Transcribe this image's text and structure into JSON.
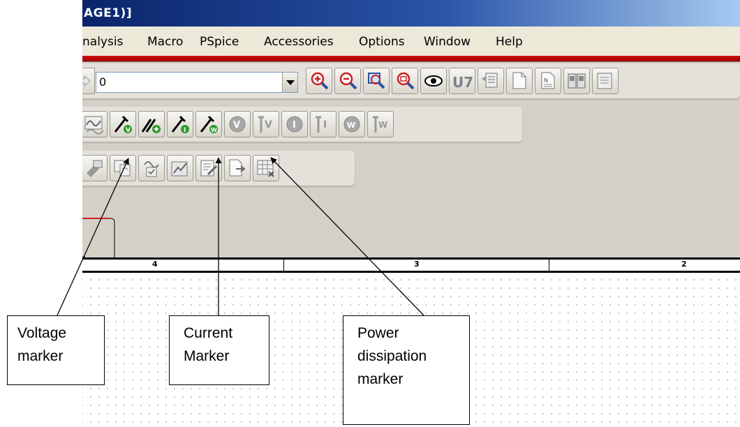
{
  "window": {
    "title": "AGE1)]"
  },
  "menu": [
    "nalysis",
    "Macro",
    "PSpice",
    "Accessories",
    "Options",
    "Window",
    "Help"
  ],
  "toolbar1": {
    "combo_value": "0",
    "icons": [
      "zoom-in-icon",
      "zoom-out-icon",
      "zoom-area-icon",
      "zoom-all-icon",
      "eye-icon",
      "u7-icon",
      "part-list-icon",
      "page-icon",
      "netlist-icon",
      "annotate-icon",
      "report-icon"
    ]
  },
  "toolbar2": {
    "icons": [
      "simulation-waveform-icon",
      "voltage-marker-icon",
      "voltage-differential-marker-icon",
      "current-marker-icon",
      "power-marker-icon",
      "bias-voltage-icon",
      "enable-voltage-icon",
      "bias-current-icon",
      "enable-current-icon",
      "bias-power-icon",
      "enable-power-icon"
    ]
  },
  "toolbar3": {
    "icons": [
      "simulation-setup-icon",
      "copy-profile-icon",
      "run-check-icon",
      "view-results-icon",
      "edit-text-icon",
      "export-icon",
      "table-icon"
    ]
  },
  "ruler": {
    "labels": [
      "4",
      "3",
      "2"
    ]
  },
  "callouts": {
    "voltage": [
      "Voltage",
      "marker"
    ],
    "current": [
      "Current",
      "Marker"
    ],
    "power": [
      "Power",
      "dissipation",
      "marker"
    ]
  },
  "colors": {
    "title_start": "#0a246a",
    "title_end": "#a6caf0",
    "accent_red": "#c00000",
    "marker_green": "#2e9c2e"
  }
}
